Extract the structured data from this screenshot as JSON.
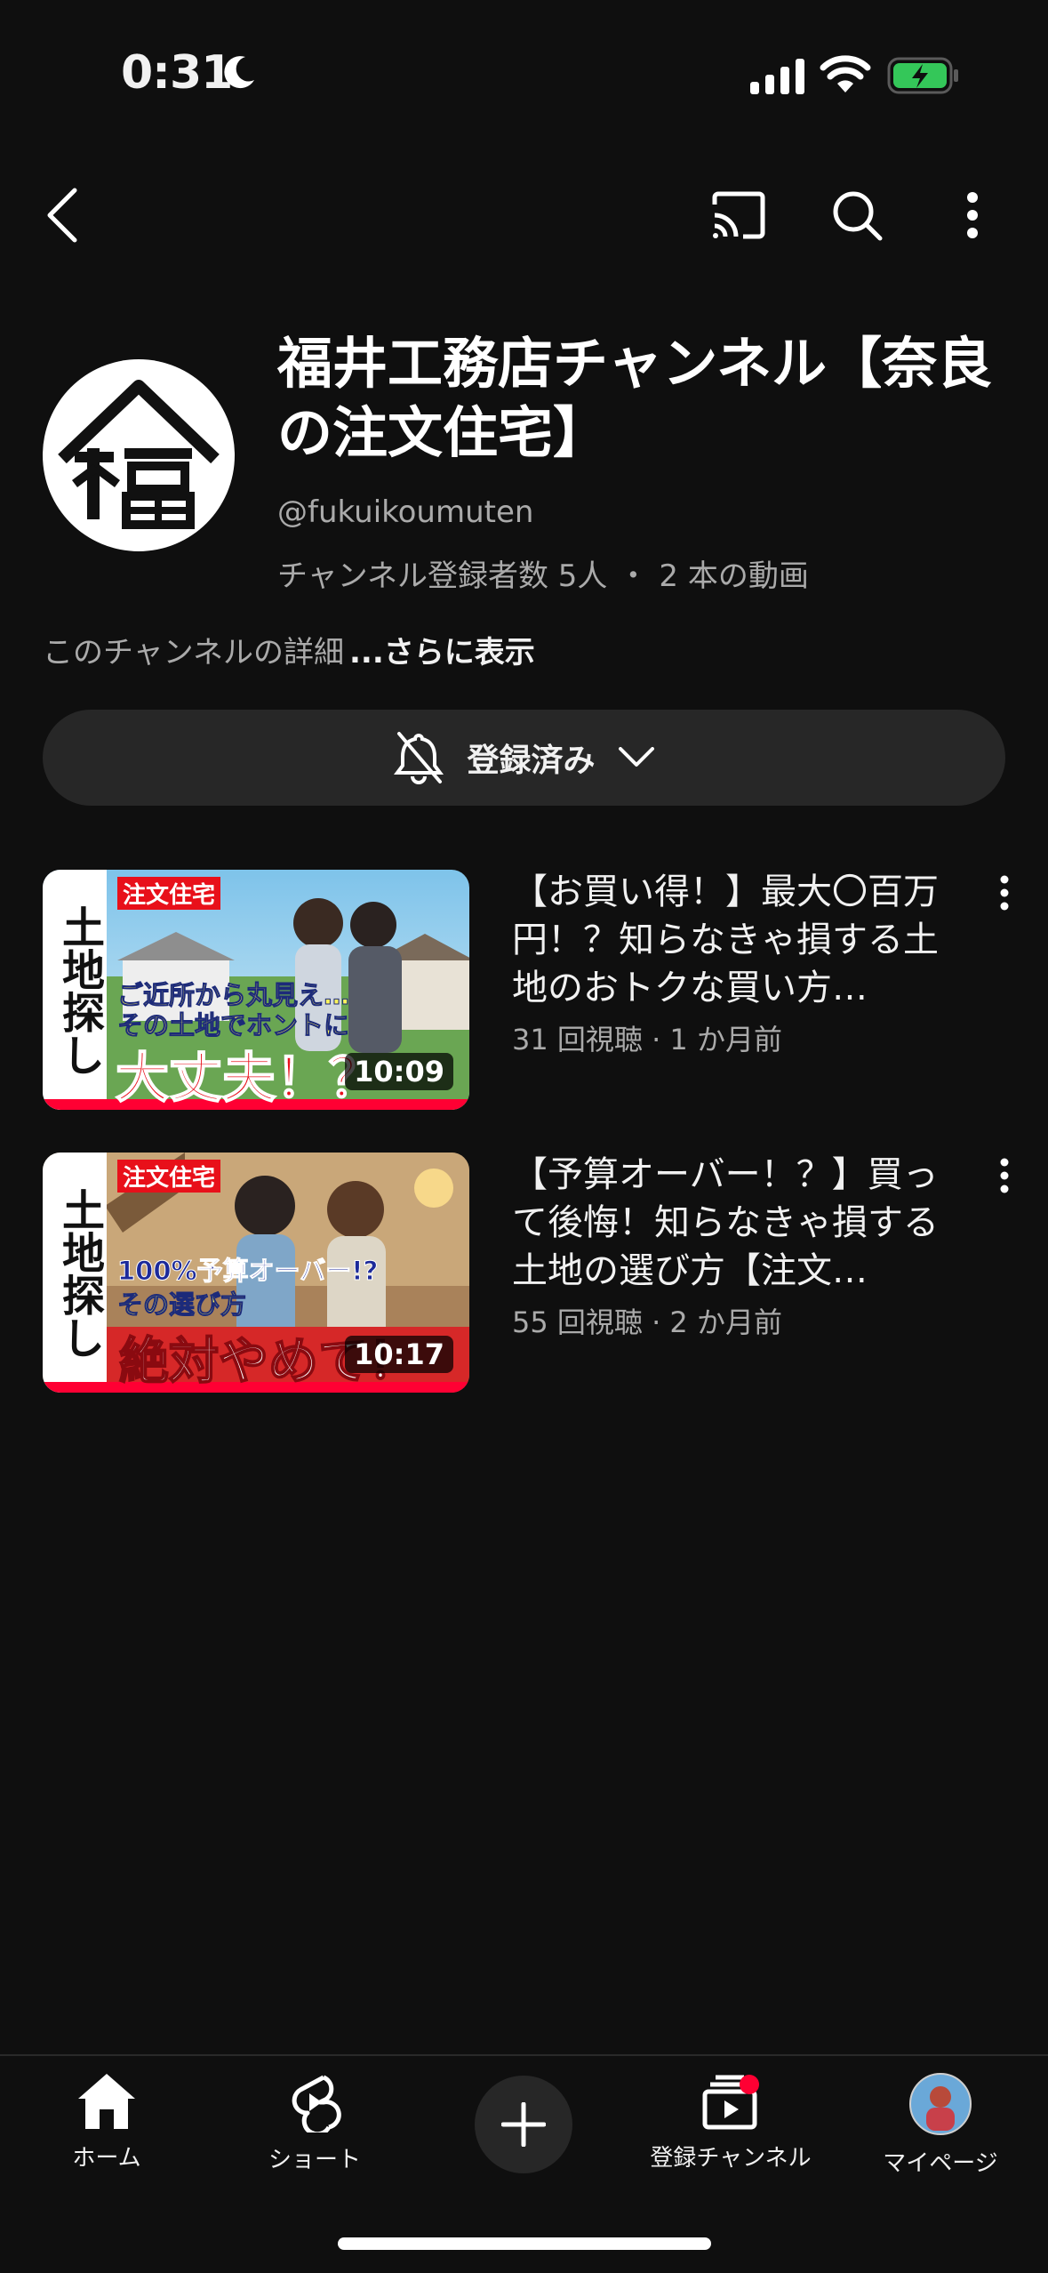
{
  "status_bar": {
    "time": "0:31"
  },
  "channel": {
    "title": "福井工務店チャンネル【奈良の注文住宅】",
    "handle": "@fukuikoumuten",
    "subscribers": "チャンネル登録者数 5人",
    "separator": "・",
    "video_count": "2 本の動画",
    "description": "このチャンネルの詳細",
    "more_label": "...さらに表示",
    "subscribe_label": "登録済み"
  },
  "videos": [
    {
      "title": "【お買い得！】最大〇百万円！？知らなきゃ損する土地のおトクな買い方…",
      "views": "31 回視聴",
      "age": "1 か月前",
      "duration": "10:09",
      "thumb_side_text": "土地探し",
      "thumb_tag": "注文住宅",
      "thumb_line1": "ご近所から丸見え…",
      "thumb_line2": "その土地でホントに",
      "thumb_big": "大丈夫！？"
    },
    {
      "title": "【予算オーバー！？】買って後悔！知らなきゃ損する土地の選び方【注文…",
      "views": "55 回視聴",
      "age": "2 か月前",
      "duration": "10:17",
      "thumb_side_text": "土地探し",
      "thumb_tag": "注文住宅",
      "thumb_line1": "100%予算オーバー!?",
      "thumb_line2": "その選び方",
      "thumb_big": "絶対やめて！"
    }
  ],
  "bottom_nav": {
    "home": "ホーム",
    "shorts": "ショート",
    "subscriptions": "登録チャンネル",
    "mypage": "マイページ"
  },
  "colors": {
    "background": "#0f0f0f",
    "surface": "#272727",
    "accent_red": "#ff0033",
    "battery_green": "#34c759"
  }
}
